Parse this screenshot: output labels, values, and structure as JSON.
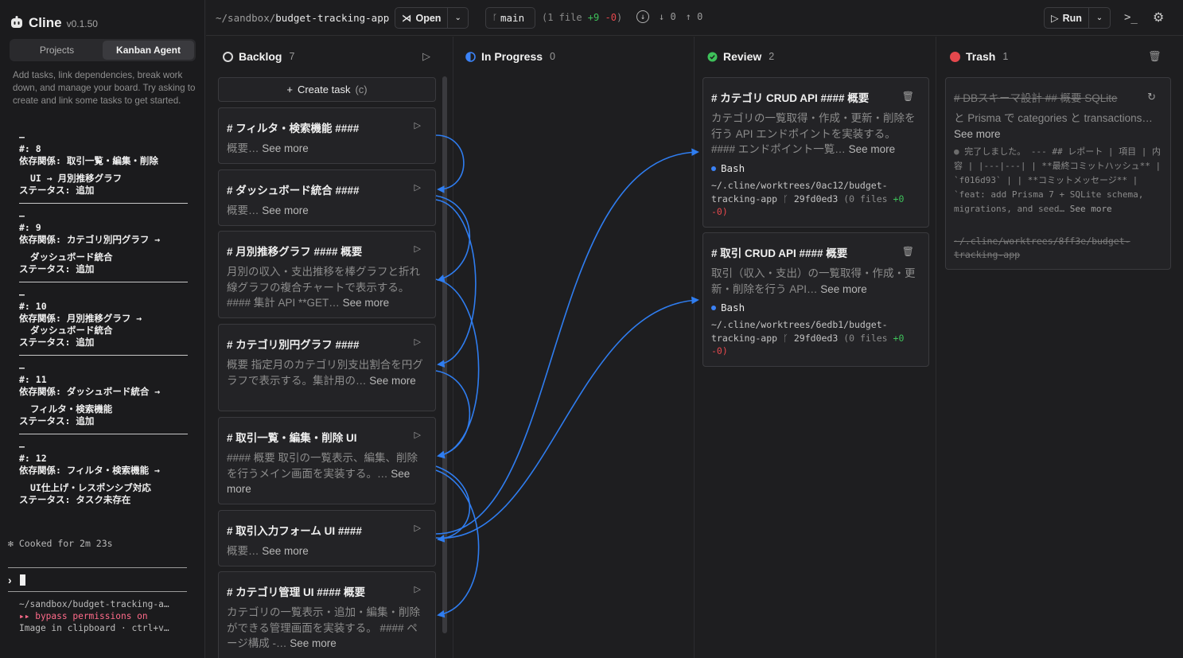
{
  "sidebar": {
    "app_name": "Cline",
    "version": "v0.1.50",
    "tabs": [
      "Projects",
      "Kanban Agent"
    ],
    "intro": "Add tasks, link dependencies, break work down, and manage your board. Try asking to create and link some tasks to get started.",
    "log": [
      {
        "num": "#: 8",
        "dep": "依存関係: 取引一覧・編集・削除",
        "target": "UI → 月別推移グラフ",
        "status": "ステータス: 追加"
      },
      {
        "num": "#: 9",
        "dep": "依存関係: カテゴリ別円グラフ →",
        "target": "ダッシュボード統合",
        "status": "ステータス: 追加"
      },
      {
        "num": "#: 10",
        "dep": "依存関係: 月別推移グラフ →",
        "target": "ダッシュボード統合",
        "status": "ステータス: 追加"
      },
      {
        "num": "#: 11",
        "dep": "依存関係: ダッシュボード統合 →",
        "target": "フィルタ・検索機能",
        "status": "ステータス: 追加"
      },
      {
        "num": "#: 12",
        "dep": "依存関係: フィルタ・検索機能 →",
        "target": "UI仕上げ・レスポンシブ対応",
        "status": "ステータス: タスク未存在"
      }
    ],
    "cooked": "Cooked for 2m 23s",
    "footer_path": "~/sandbox/budget-tracking-a…",
    "footer_permissions": "▸▸ bypass permissions on",
    "footer_clipboard": "Image in clipboard · ctrl+v…"
  },
  "topbar": {
    "path_prefix": "~/sandbox/",
    "path_name": "budget-tracking-app",
    "open_label": "Open",
    "branch": "main",
    "diff_prefix": "(1 file ",
    "diff_add": "+9",
    "diff_del": "-0",
    "diff_suffix": ")",
    "behind": "0",
    "ahead": "0",
    "run_label": "Run"
  },
  "columns": {
    "backlog": {
      "title": "Backlog",
      "count": "7",
      "color": "#d0d0d0"
    },
    "in_progress": {
      "title": "In Progress",
      "count": "0",
      "color": "#3b82f6"
    },
    "review": {
      "title": "Review",
      "count": "2",
      "color": "#3ec15a"
    },
    "trash": {
      "title": "Trash",
      "count": "1",
      "color": "#e5484d"
    }
  },
  "create_task": {
    "label": "Create task",
    "shortcut": "(c)"
  },
  "backlog_cards": [
    {
      "title": "# フィルタ・検索機能 ####",
      "body": "概要…",
      "more": "See more"
    },
    {
      "title": "# ダッシュボード統合 ####",
      "body": "概要…",
      "more": "See more"
    },
    {
      "title": "# 月別推移グラフ #### 概要",
      "body": "月別の収入・支出推移を棒グラフと折れ線グラフの複合チャートで表示する。 #### 集計 API **GET…",
      "more": "See more"
    },
    {
      "title": "# カテゴリ別円グラフ ####",
      "body": "概要 指定月のカテゴリ別支出割合を円グラフで表示する。集計用の…",
      "more": "See more"
    },
    {
      "title": "# 取引一覧・編集・削除 UI",
      "body": "#### 概要 取引の一覧表示、編集、削除を行うメイン画面を実装する。…",
      "more": "See more"
    },
    {
      "title": "# 取引入力フォーム UI ####",
      "body": "概要…",
      "more": "See more"
    },
    {
      "title": "# カテゴリ管理 UI #### 概要",
      "body": "カテゴリの一覧表示・追加・編集・削除ができる管理画面を実装する。 #### ページ構成 -…",
      "more": "See more"
    }
  ],
  "review_cards": [
    {
      "title": "# カテゴリ CRUD API #### 概要",
      "body": "カテゴリの一覧取得・作成・更新・削除を行う API エンドポイントを実装する。 #### エンドポイント一覧…",
      "more": "See more",
      "tool": "Bash",
      "worktree": "~/.cline/worktrees/0ac12/budget-tracking-app",
      "commit": "29fd0ed3",
      "files": "(0 files ",
      "add": "+0",
      "del": "-0)"
    },
    {
      "title": "# 取引 CRUD API #### 概要",
      "body": "取引（収入・支出）の一覧取得・作成・更新・削除を行う API…",
      "more": "See more",
      "tool": "Bash",
      "worktree": "~/.cline/worktrees/6edb1/budget-tracking-app",
      "commit": "29fd0ed3",
      "files": "(0 files ",
      "add": "+0",
      "del": "-0)"
    }
  ],
  "trash_card": {
    "title": "# DBスキーマ設計 ## 概要 SQLite",
    "body": "と Prisma で categories と transactions…",
    "more": "See more",
    "report": "完了しました。 --- ## レポート | 項目 | 内容 | |---|---| | **最終コミットハッシュ** | `f016d93` | | **コミットメッセージ** | `feat: add Prisma 7 + SQLite schema, migrations, and seed…",
    "report_more": "See more",
    "worktree": "~/.cline/worktrees/8ff3e/budget-tracking-app"
  }
}
